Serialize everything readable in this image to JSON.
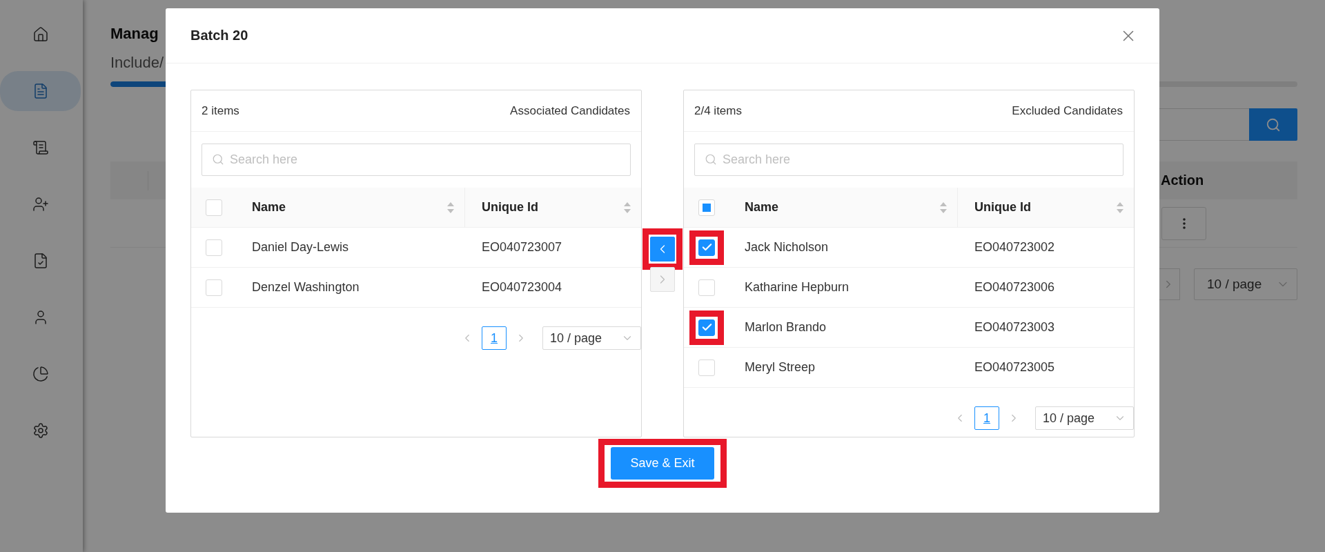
{
  "sidebar": {
    "items": [
      {
        "kind": "home",
        "selected": false
      },
      {
        "kind": "document",
        "selected": true
      },
      {
        "kind": "report",
        "selected": false
      },
      {
        "kind": "user-add",
        "selected": false
      },
      {
        "kind": "approved",
        "selected": false
      },
      {
        "kind": "user",
        "selected": false
      },
      {
        "kind": "chart",
        "selected": false
      },
      {
        "kind": "settings",
        "selected": false
      }
    ]
  },
  "page": {
    "title": "Manag",
    "subtitle": "Include/",
    "progress": {
      "level": 0.5
    },
    "table": {
      "columns": [
        "Action"
      ]
    },
    "pagination": {
      "page_size": "10 / page"
    }
  },
  "modal": {
    "title": "Batch 20",
    "panels": [
      {
        "count": "2 items",
        "title": "Associated Candidates",
        "search": {
          "placeholder": "Search here"
        },
        "columns": [
          "Name",
          "Unique Id"
        ],
        "select_all": {
          "checked": false,
          "indeterminate": false
        },
        "rows": [
          {
            "name": "Daniel Day-Lewis",
            "id": "EO040723007",
            "checked": false,
            "highlighted": false
          },
          {
            "name": "Denzel Washington",
            "id": "EO040723004",
            "checked": false,
            "highlighted": false
          }
        ],
        "pagination": {
          "pages": [
            {
              "label": "1",
              "selected": true
            }
          ],
          "page_size": "10 / page"
        }
      },
      {
        "count": "2/4 items",
        "title": "Excluded Candidates",
        "search": {
          "placeholder": "Search here"
        },
        "columns": [
          "Name",
          "Unique Id"
        ],
        "select_all": {
          "checked": false,
          "indeterminate": true
        },
        "rows": [
          {
            "name": "Jack Nicholson",
            "id": "EO040723002",
            "checked": true,
            "highlighted": true
          },
          {
            "name": "Katharine Hepburn",
            "id": "EO040723006",
            "checked": false,
            "highlighted": false
          },
          {
            "name": "Marlon Brando",
            "id": "EO040723003",
            "checked": true,
            "highlighted": true
          },
          {
            "name": "Meryl Streep",
            "id": "EO040723005",
            "checked": false,
            "highlighted": false
          }
        ],
        "pagination": {
          "pages": [
            {
              "label": "1",
              "selected": true
            }
          ],
          "page_size": "10 / page"
        }
      }
    ],
    "move_left": {
      "disabled": false,
      "highlighted": true
    },
    "move_right": {
      "disabled": true,
      "highlighted": false
    },
    "save_button": {
      "label": "Save & Exit",
      "highlighted": true
    }
  }
}
